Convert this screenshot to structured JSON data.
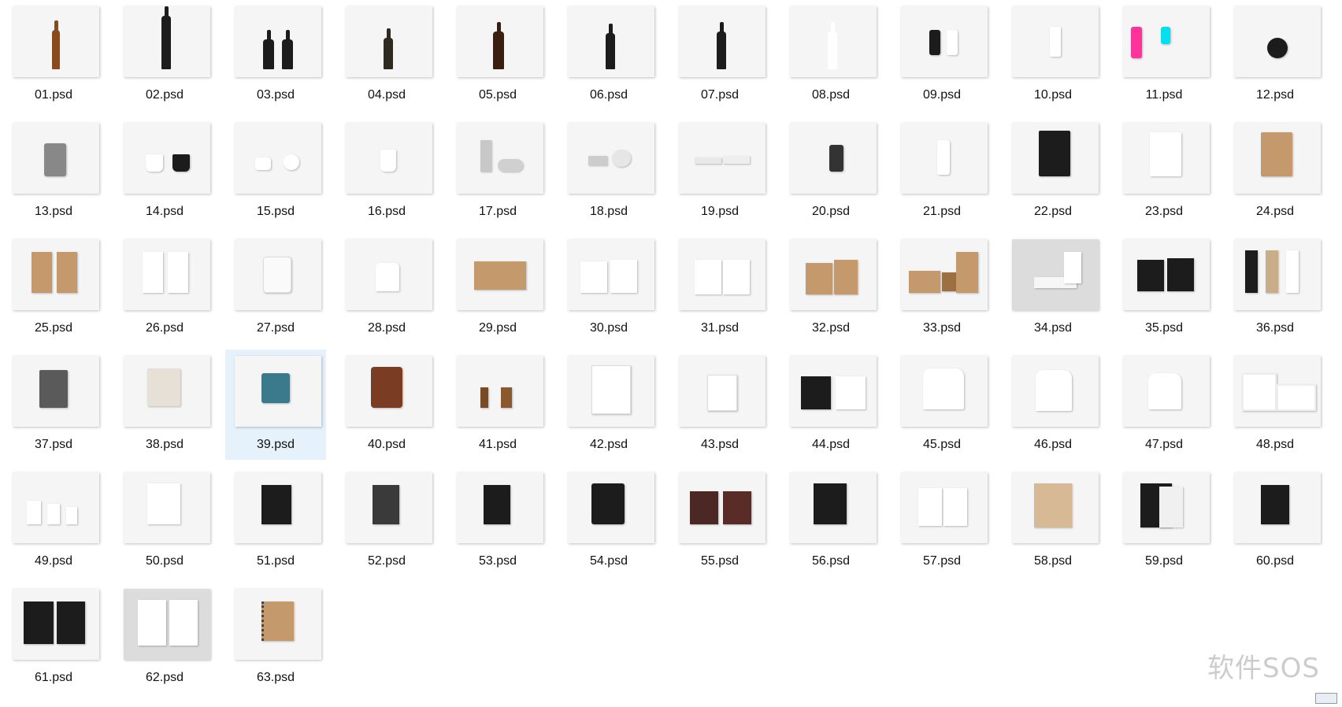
{
  "files": [
    {
      "name": "01.psd",
      "kind": "brown-bottle"
    },
    {
      "name": "02.psd",
      "kind": "wine-bottle-black"
    },
    {
      "name": "03.psd",
      "kind": "two-black-bottles"
    },
    {
      "name": "04.psd",
      "kind": "small-dark-bottle"
    },
    {
      "name": "05.psd",
      "kind": "brown-bottle-wide"
    },
    {
      "name": "06.psd",
      "kind": "black-bottle"
    },
    {
      "name": "07.psd",
      "kind": "swing-top-bottle"
    },
    {
      "name": "08.psd",
      "kind": "white-bottle"
    },
    {
      "name": "09.psd",
      "kind": "black-white-cans"
    },
    {
      "name": "10.psd",
      "kind": "white-cup"
    },
    {
      "name": "11.psd",
      "kind": "colorful-bottles"
    },
    {
      "name": "12.psd",
      "kind": "round-black-flask"
    },
    {
      "name": "13.psd",
      "kind": "hip-flask"
    },
    {
      "name": "14.psd",
      "kind": "two-mugs"
    },
    {
      "name": "15.psd",
      "kind": "jug-and-jar"
    },
    {
      "name": "16.psd",
      "kind": "white-mug"
    },
    {
      "name": "17.psd",
      "kind": "tin-cans"
    },
    {
      "name": "18.psd",
      "kind": "small-tins"
    },
    {
      "name": "19.psd",
      "kind": "flat-boxes"
    },
    {
      "name": "20.psd",
      "kind": "oil-can"
    },
    {
      "name": "21.psd",
      "kind": "white-tube-can"
    },
    {
      "name": "22.psd",
      "kind": "black-pouch"
    },
    {
      "name": "23.psd",
      "kind": "white-pouch"
    },
    {
      "name": "24.psd",
      "kind": "kraft-pouch"
    },
    {
      "name": "25.psd",
      "kind": "kraft-bags"
    },
    {
      "name": "26.psd",
      "kind": "white-bags"
    },
    {
      "name": "27.psd",
      "kind": "glass-jar"
    },
    {
      "name": "28.psd",
      "kind": "tied-bag"
    },
    {
      "name": "29.psd",
      "kind": "kraft-parcel"
    },
    {
      "name": "30.psd",
      "kind": "white-shopping-bags"
    },
    {
      "name": "31.psd",
      "kind": "white-paper-bags"
    },
    {
      "name": "32.psd",
      "kind": "kraft-shopping-bags"
    },
    {
      "name": "33.psd",
      "kind": "kraft-boxes"
    },
    {
      "name": "34.psd",
      "kind": "white-boxes-gray-bg"
    },
    {
      "name": "35.psd",
      "kind": "black-folders"
    },
    {
      "name": "36.psd",
      "kind": "tubes"
    },
    {
      "name": "37.psd",
      "kind": "gray-notebook"
    },
    {
      "name": "38.psd",
      "kind": "linen-notebook"
    },
    {
      "name": "39.psd",
      "kind": "teal-wallet"
    },
    {
      "name": "40.psd",
      "kind": "leather-notebook"
    },
    {
      "name": "41.psd",
      "kind": "wooden-stamps"
    },
    {
      "name": "42.psd",
      "kind": "white-tablet"
    },
    {
      "name": "43.psd",
      "kind": "white-card"
    },
    {
      "name": "44.psd",
      "kind": "tote-bags"
    },
    {
      "name": "45.psd",
      "kind": "t-shirt"
    },
    {
      "name": "46.psd",
      "kind": "t-shirt-hanger"
    },
    {
      "name": "47.psd",
      "kind": "t-shirt-small"
    },
    {
      "name": "48.psd",
      "kind": "photo-frames"
    },
    {
      "name": "49.psd",
      "kind": "paper-cups"
    },
    {
      "name": "50.psd",
      "kind": "white-notebook"
    },
    {
      "name": "51.psd",
      "kind": "black-notebook-band"
    },
    {
      "name": "52.psd",
      "kind": "dark-gray-notebook"
    },
    {
      "name": "53.psd",
      "kind": "black-notebook"
    },
    {
      "name": "54.psd",
      "kind": "black-leather-notebook"
    },
    {
      "name": "55.psd",
      "kind": "brown-folders"
    },
    {
      "name": "56.psd",
      "kind": "black-folio"
    },
    {
      "name": "57.psd",
      "kind": "white-folders"
    },
    {
      "name": "58.psd",
      "kind": "kraft-cover"
    },
    {
      "name": "59.psd",
      "kind": "black-white-books"
    },
    {
      "name": "60.psd",
      "kind": "black-book"
    },
    {
      "name": "61.psd",
      "kind": "black-boxes"
    },
    {
      "name": "62.psd",
      "kind": "white-books-gray-bg"
    },
    {
      "name": "63.psd",
      "kind": "spiral-notebook"
    }
  ],
  "selected_file": "39.psd",
  "watermark": "软件SOS",
  "colors": {
    "selection": "#e5f1fb",
    "thumb_bg": "#f5f5f5",
    "black": "#1c1c1c",
    "kraft": "#c49a6c",
    "brown_bottle": "#8a4a1c",
    "teal": "#3a7a8c",
    "leather": "#7a3c22"
  }
}
